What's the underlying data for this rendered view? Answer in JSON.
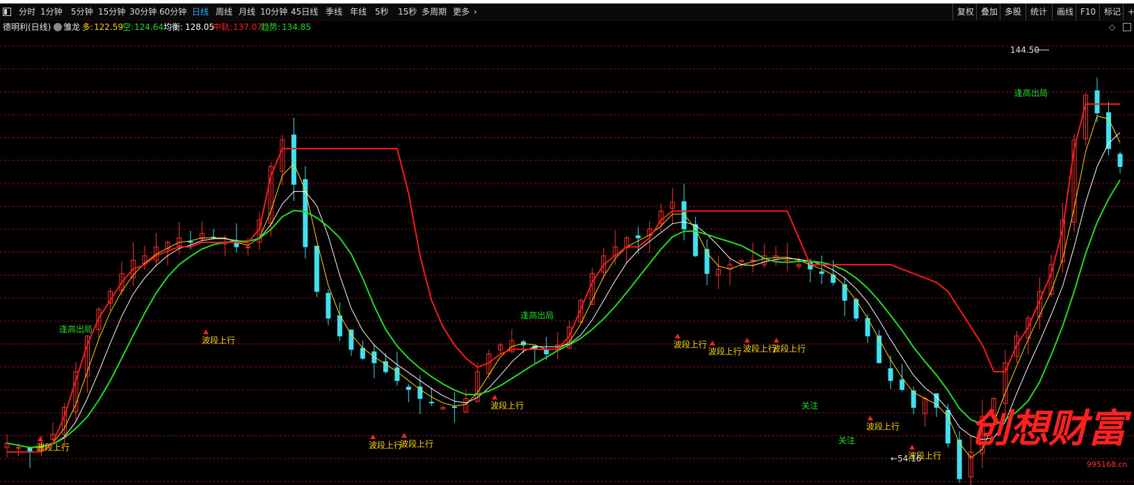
{
  "toolbar": {
    "left_icon": "window-icon",
    "periods": [
      "分时",
      "1分钟",
      "5分钟",
      "15分钟",
      "30分钟",
      "60分钟",
      "日线",
      "周线",
      "月线",
      "10分钟",
      "45日线",
      "季线",
      "年线",
      "5秒",
      "15秒",
      "多周期",
      "更多"
    ],
    "active_period": "日线",
    "right_buttons": [
      "复权",
      "叠加",
      "多股",
      "统计",
      "画线",
      "F10",
      "标记",
      "+自"
    ]
  },
  "info": {
    "stock_title": "德明利(日线)",
    "indicator_name": "雏龙",
    "duo_label": "多:",
    "duo_value": "122.59",
    "kong_label": "空:",
    "kong_value": "124.64",
    "junheng_label": "均衡:",
    "junheng_value": "128.05",
    "zhonggui_label": "中轨:",
    "zhonggui_value": "137.07",
    "qushi_label": "趋势:",
    "qushi_value": "134.85"
  },
  "markers": {
    "wave_up": "波段上行",
    "high_exit": "逢高出局",
    "attention": "关注"
  },
  "price_marks": {
    "high": "144.50",
    "low": "54.16"
  },
  "watermark": {
    "brand": "创想财富",
    "site": "995168.cn"
  },
  "colors": {
    "up_candle": "#ff3030",
    "down_candle": "#40e0f0",
    "red_line": "#ff1a1a",
    "green_line": "#22dd22",
    "white_line": "#ffffff",
    "yellow_line": "#ffd700",
    "grid": "#8b1010",
    "active_tab": "#2fa8ff"
  },
  "chart_data": {
    "type": "candlestick",
    "price_range": [
      54.16,
      144.5
    ],
    "closes": [
      62,
      61,
      60,
      62,
      64,
      70,
      78,
      86,
      92,
      96,
      100,
      103,
      104,
      106,
      107,
      108,
      107,
      109,
      108,
      107,
      106,
      106,
      112,
      124,
      130,
      120,
      106,
      96,
      90,
      86,
      83,
      81,
      80,
      78,
      76,
      74,
      72,
      71,
      70,
      70,
      72,
      78,
      82,
      84,
      85,
      84,
      83,
      82,
      84,
      88,
      94,
      100,
      104,
      106,
      108,
      108,
      110,
      114,
      116,
      110,
      104,
      100,
      101,
      102,
      103,
      103,
      104,
      104,
      103,
      102,
      101,
      100,
      98,
      94,
      90,
      86,
      80,
      76,
      74,
      70,
      72,
      70,
      62,
      54,
      60,
      68,
      72,
      80,
      86,
      90,
      96,
      102,
      112,
      130,
      140,
      136,
      128,
      124
    ]
  }
}
